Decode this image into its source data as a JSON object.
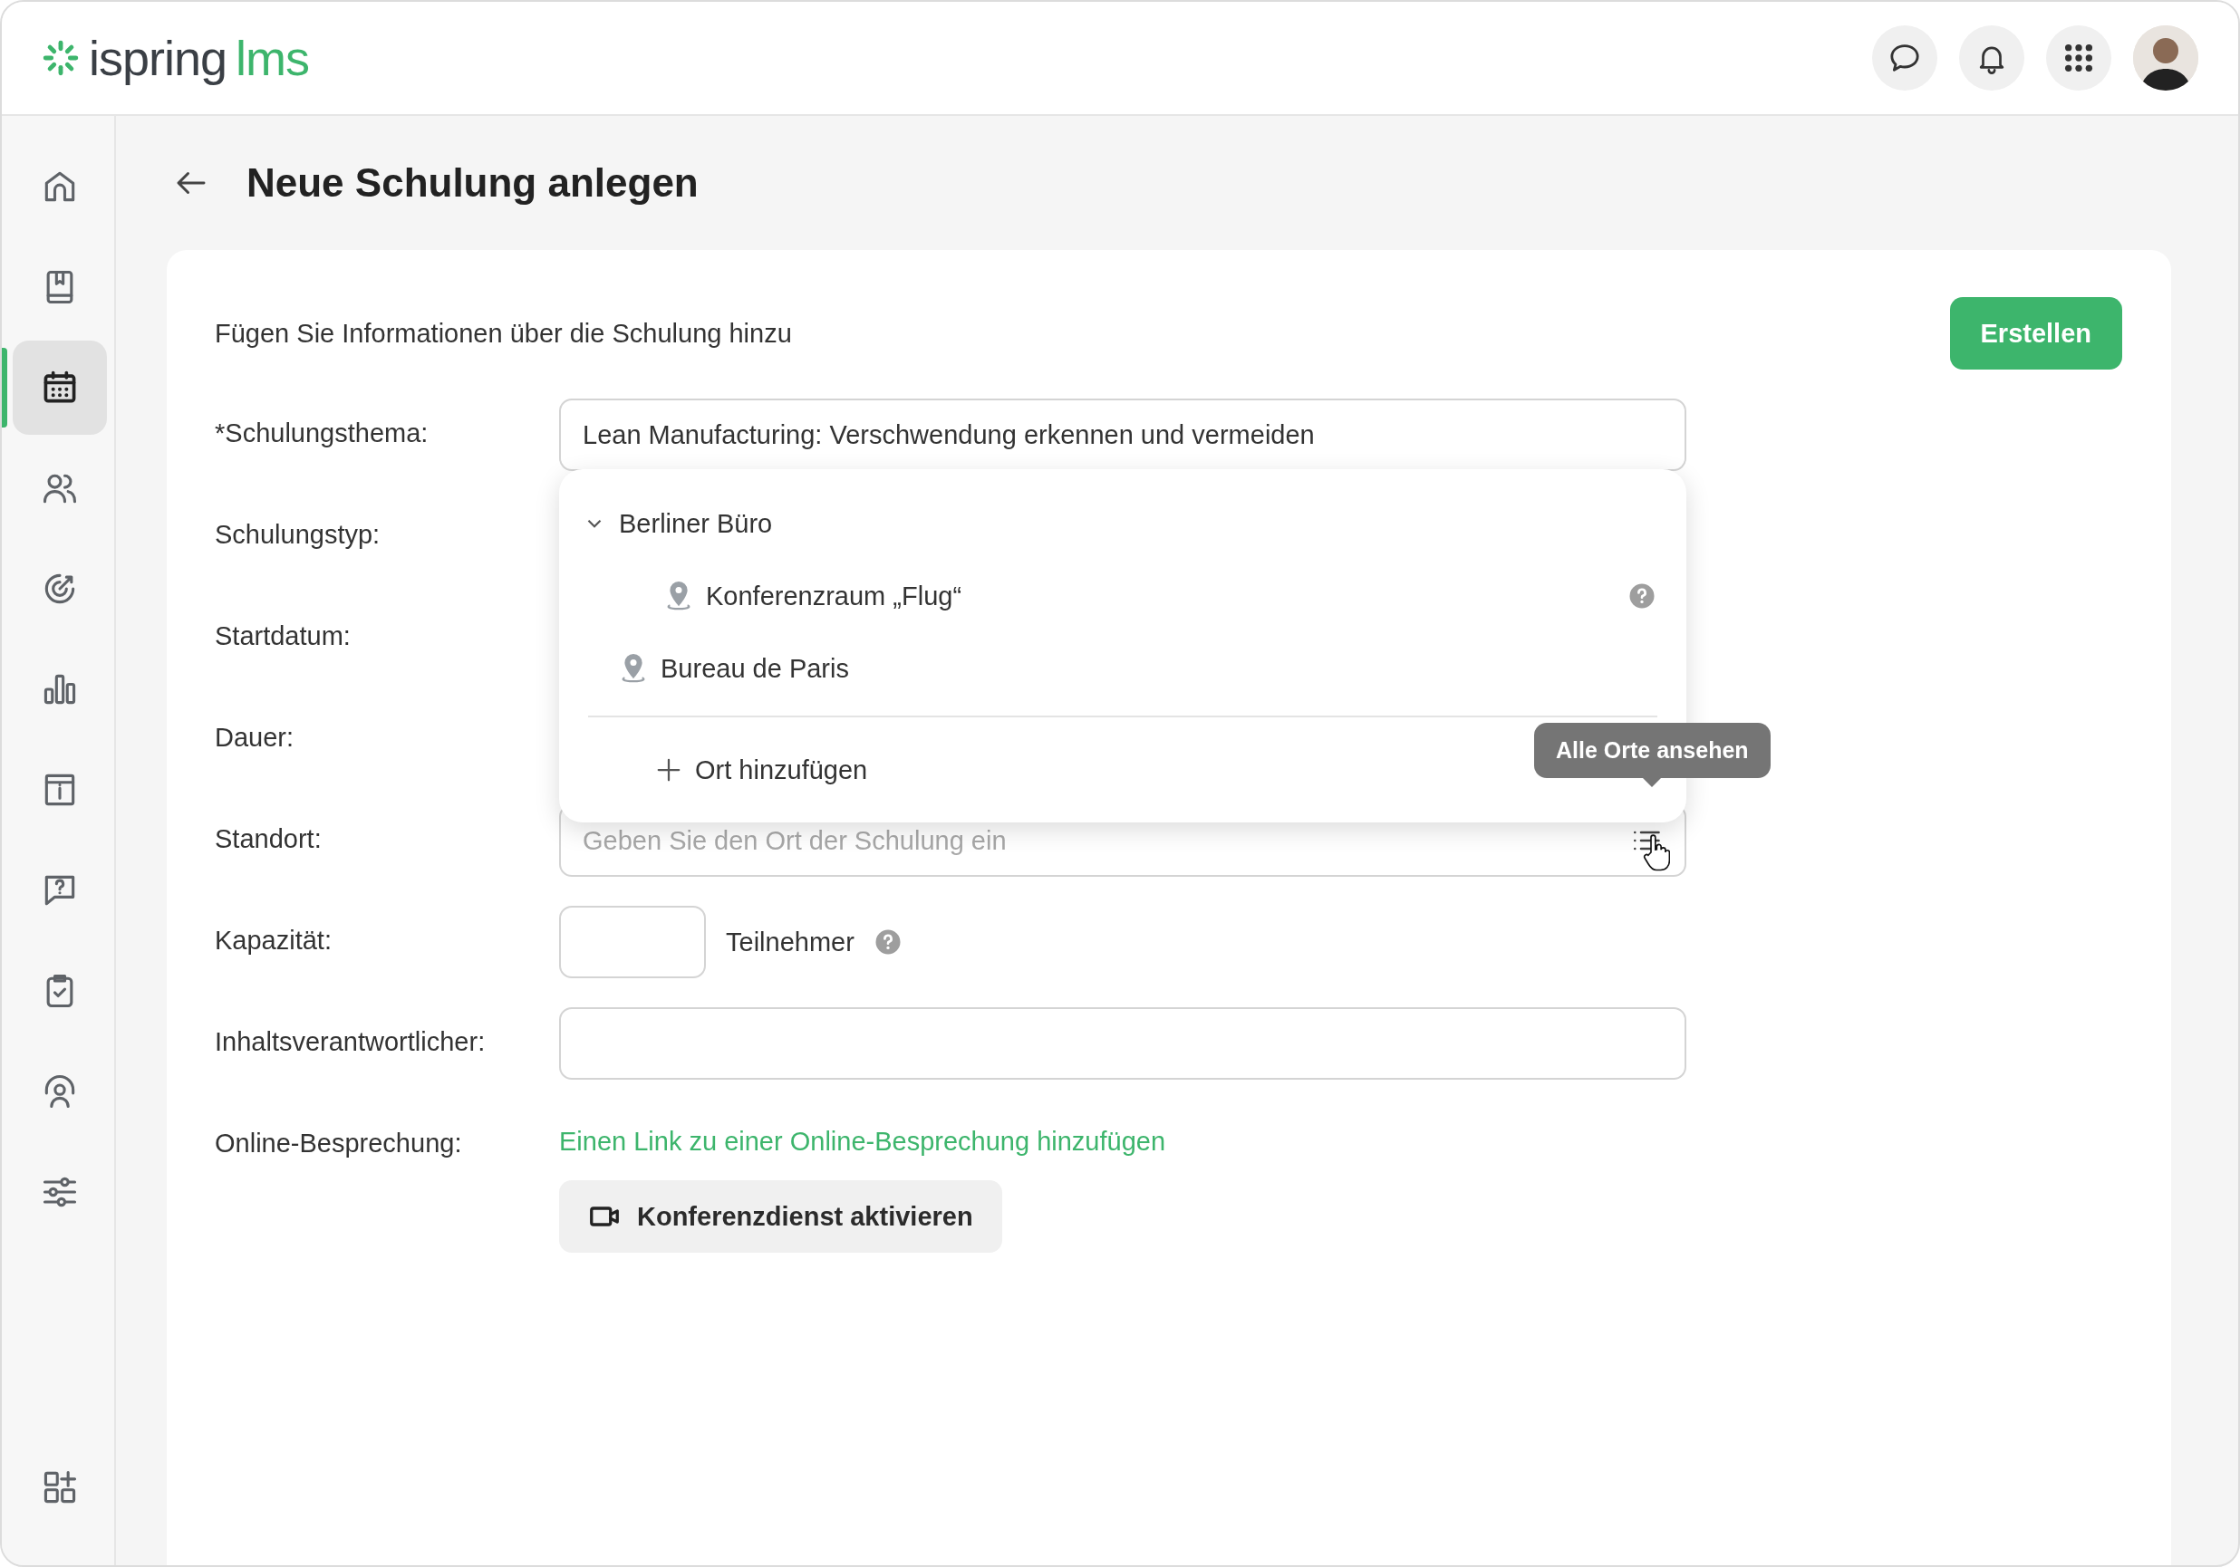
{
  "header": {
    "logo": {
      "brand": "ispring",
      "product": "lms"
    }
  },
  "sidebar": {
    "items": [
      {
        "selected": false
      },
      {
        "selected": false
      },
      {
        "selected": true
      },
      {
        "selected": false
      },
      {
        "selected": false
      },
      {
        "selected": false
      },
      {
        "selected": false
      },
      {
        "selected": false
      },
      {
        "selected": false
      },
      {
        "selected": false
      },
      {
        "selected": false
      },
      {
        "selected": false
      }
    ]
  },
  "page": {
    "title": "Neue Schulung anlegen"
  },
  "card": {
    "intro": "Fügen Sie Informationen über die Schulung hinzu",
    "create_button": "Erstellen"
  },
  "form": {
    "rows": [
      {
        "label": "*Schulungsthema:",
        "kind": "text",
        "value": "Lean Manufacturing: Verschwendung erkennen und vermeiden"
      },
      {
        "label": "Schulungstyp:",
        "kind": "covered"
      },
      {
        "label": "Startdatum:",
        "kind": "covered"
      },
      {
        "label": "Dauer:",
        "kind": "covered"
      },
      {
        "label": "Standort:",
        "kind": "location",
        "placeholder": "Geben Sie den Ort der Schulung ein"
      },
      {
        "label": "Kapazität:",
        "kind": "number",
        "unit": "Teilnehmer"
      },
      {
        "label": "Inhaltsverantwortlicher:",
        "kind": "text"
      },
      {
        "label": "Online-Besprechung:",
        "kind": "online",
        "link": "Einen Link zu einer Online-Besprechung hinzufügen",
        "button": "Konferenzdienst aktivieren"
      }
    ]
  },
  "location_dropdown": {
    "items": [
      {
        "label": "Berliner Büro",
        "expanded": true,
        "help": false,
        "children": [
          {
            "label": "Konferenzraum „Flug“",
            "help": true
          }
        ]
      },
      {
        "label": "Bureau de Paris",
        "help": false
      }
    ],
    "add_label": "Ort hinzufügen"
  },
  "tooltip": {
    "text": "Alle Orte ansehen"
  }
}
